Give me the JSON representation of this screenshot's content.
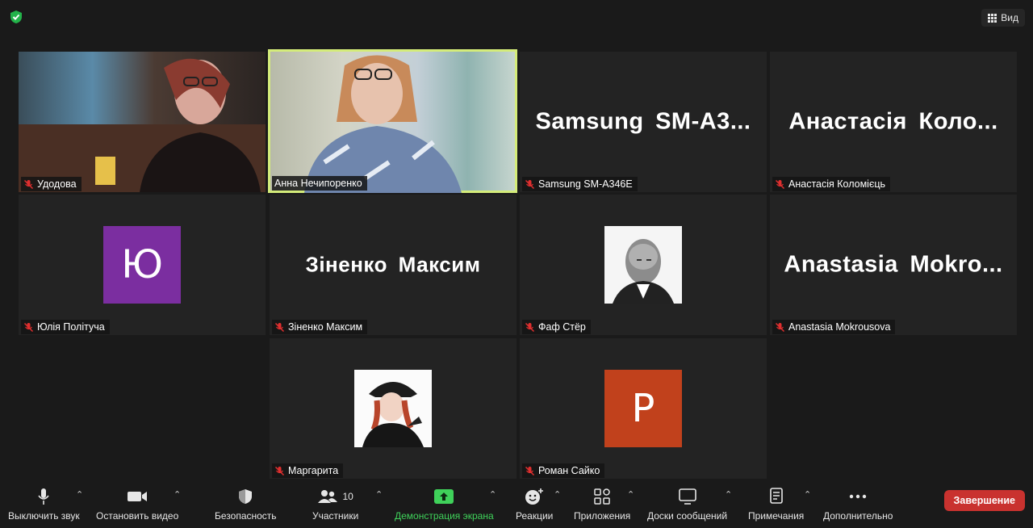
{
  "header": {
    "view_label": "Вид"
  },
  "tiles": [
    {
      "label": "Удодова",
      "type": "video"
    },
    {
      "label": "Анна Нечипоренко",
      "type": "video"
    },
    {
      "label": "Samsung SM-A346E",
      "display": "Samsung  SM-A3..."
    },
    {
      "label": "Анастасія Коломієць",
      "display": "Анастасія  Коло..."
    },
    {
      "label": "Юлія Політуча",
      "avatar_letter": "Ю",
      "avatar_color": "#7b2ea0"
    },
    {
      "label": "Зіненко Максим",
      "display": "Зіненко Максим"
    },
    {
      "label": "Фаф Стёр",
      "type": "photo"
    },
    {
      "label": "Anastasia Mokrousova",
      "display": "Anastasia  Mokro..."
    },
    {
      "label": "Маргарита",
      "type": "photo"
    },
    {
      "label": "Роман Сайко",
      "avatar_letter": "P",
      "avatar_color": "#c1411c"
    }
  ],
  "toolbar": {
    "mute": "Выключить звук",
    "stop_video": "Остановить видео",
    "security": "Безопасность",
    "participants": "Участники",
    "participants_count": "10",
    "share_screen": "Демонстрация экрана",
    "reactions": "Реакции",
    "apps": "Приложения",
    "whiteboards": "Доски сообщений",
    "notes": "Примечания",
    "more": "Дополнительно",
    "end": "Завершение"
  },
  "colors": {
    "active_speaker": "#d4ec7a",
    "share_green": "#3fd15a",
    "end_red": "#c9322f"
  }
}
